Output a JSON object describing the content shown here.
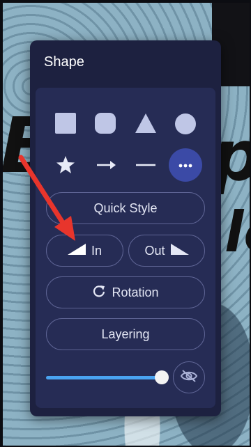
{
  "panel": {
    "title": "Shape",
    "shapes": [
      "square-shape",
      "rounded-square-shape",
      "triangle-shape",
      "circle-shape",
      "star-shape",
      "arrow-shape",
      "line-shape"
    ],
    "more_icon": "more-horizontal-icon",
    "quick_style_label": "Quick Style",
    "in_label": "In",
    "out_label": "Out",
    "rotation_label": "Rotation",
    "layering_label": "Layering",
    "opacity_value": 0.93,
    "visibility_icon": "eye-off-icon"
  },
  "background": {
    "letters": [
      "B",
      "p",
      "le"
    ]
  },
  "colors": {
    "panel": "#1d2140",
    "inner": "#262c55",
    "accent": "#3b4aa6",
    "slider": "#4aa3f0",
    "annotation_arrow": "#e8352c"
  }
}
